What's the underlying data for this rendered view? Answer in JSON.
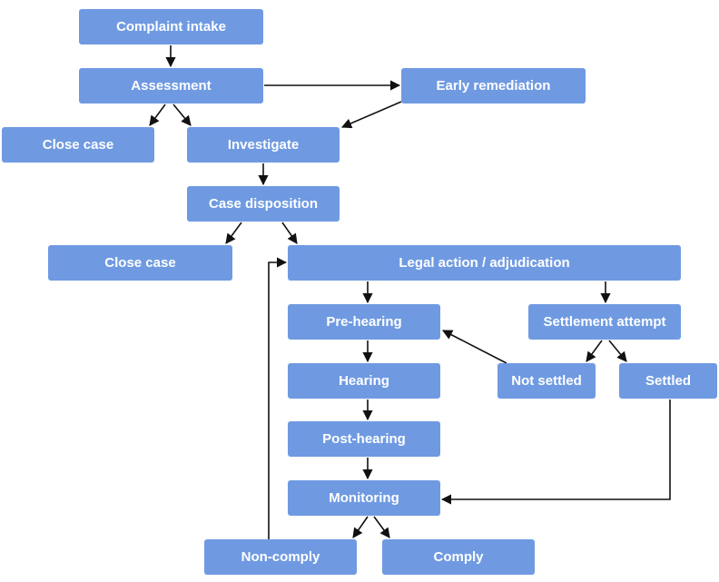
{
  "diagram": {
    "type": "flowchart",
    "colors": {
      "node_fill": "#6f9ae2",
      "node_text": "#ffffff",
      "edge": "#111111"
    },
    "nodes": {
      "complaint_intake": "Complaint intake",
      "assessment": "Assessment",
      "early_remediation": "Early remediation",
      "close_case_1": "Close case",
      "investigate": "Investigate",
      "case_disposition": "Case disposition",
      "close_case_2": "Close case",
      "legal_action": "Legal action / adjudication",
      "pre_hearing": "Pre-hearing",
      "settlement_attempt": "Settlement attempt",
      "hearing": "Hearing",
      "not_settled": "Not settled",
      "settled": "Settled",
      "post_hearing": "Post-hearing",
      "monitoring": "Monitoring",
      "non_comply": "Non-comply",
      "comply": "Comply"
    },
    "edges": [
      [
        "complaint_intake",
        "assessment"
      ],
      [
        "assessment",
        "early_remediation"
      ],
      [
        "assessment",
        "close_case_1"
      ],
      [
        "assessment",
        "investigate"
      ],
      [
        "early_remediation",
        "investigate"
      ],
      [
        "investigate",
        "case_disposition"
      ],
      [
        "case_disposition",
        "close_case_2"
      ],
      [
        "case_disposition",
        "legal_action"
      ],
      [
        "legal_action",
        "pre_hearing"
      ],
      [
        "legal_action",
        "settlement_attempt"
      ],
      [
        "pre_hearing",
        "hearing"
      ],
      [
        "settlement_attempt",
        "not_settled"
      ],
      [
        "settlement_attempt",
        "settled"
      ],
      [
        "not_settled",
        "pre_hearing"
      ],
      [
        "hearing",
        "post_hearing"
      ],
      [
        "post_hearing",
        "monitoring"
      ],
      [
        "settled",
        "monitoring"
      ],
      [
        "monitoring",
        "non_comply"
      ],
      [
        "monitoring",
        "comply"
      ],
      [
        "non_comply",
        "legal_action"
      ]
    ]
  }
}
